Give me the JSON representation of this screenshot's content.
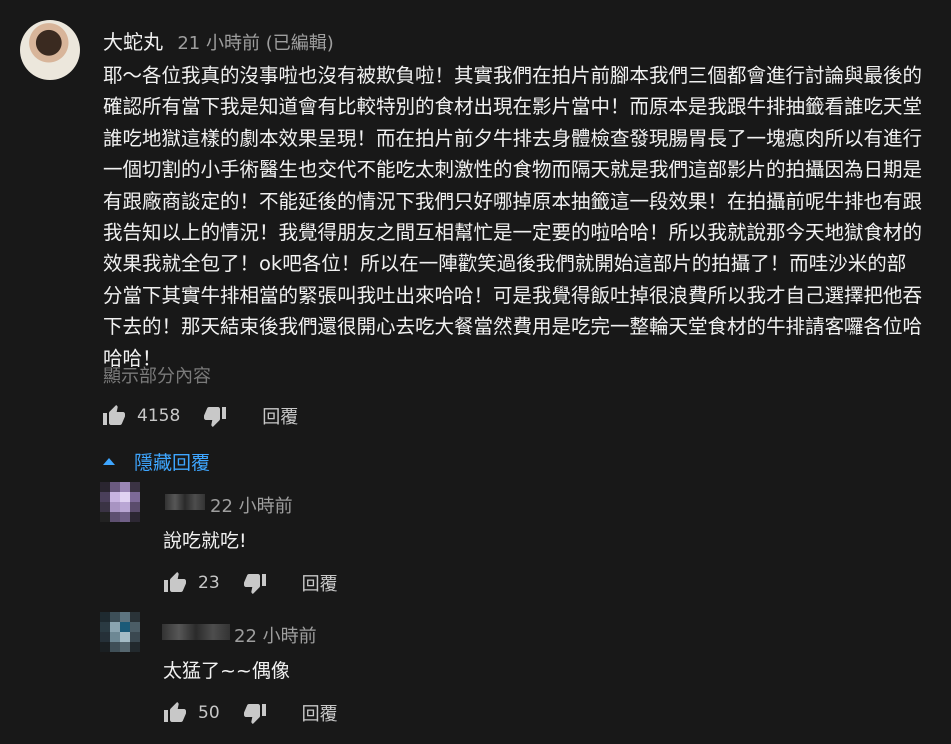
{
  "comment": {
    "author": "大蛇丸",
    "time": "21 小時前 (已編輯)",
    "text": "耶～各位我真的沒事啦也沒有被欺負啦！其實我們在拍片前腳本我們三個都會進行討論與最後的確認所有當下我是知道會有比較特別的食材出現在影片當中！而原本是我跟牛排抽籤看誰吃天堂誰吃地獄這樣的劇本效果呈現！而在拍片前夕牛排去身體檢查發現腸胃長了一塊瘜肉所以有進行一個切割的小手術醫生也交代不能吃太刺激性的食物而隔天就是我們這部影片的拍攝因為日期是有跟廠商談定的！不能延後的情況下我們只好哪掉原本抽籤這一段效果！在拍攝前呢牛排也有跟我告知以上的情況！我覺得朋友之間互相幫忙是一定要的啦哈哈！所以我就說那今天地獄食材的效果我就全包了！ok吧各位！所以在一陣歡笑過後我們就開始這部片的拍攝了！而哇沙米的部分當下其實牛排相當的緊張叫我吐出來哈哈！可是我覺得飯吐掉很浪費所以我才自己選擇把他吞下去的！那天結束後我們還很開心去吃大餐當然費用是吃完一整輪天堂食材的牛排請客囉各位哈哈哈！",
    "show_partial": "顯示部分內容",
    "likes": "4158",
    "reply_label": "回覆",
    "like_icon": "thumbs-up-icon",
    "dislike_icon": "thumbs-down-icon"
  },
  "replies_toggle": {
    "label": "隱藏回覆",
    "icon": "caret-up-icon",
    "color": "#3ea6ff"
  },
  "replies": [
    {
      "time": "22 小時前",
      "text": "說吃就吃!",
      "likes": "23",
      "reply_label": "回覆"
    },
    {
      "time": "22 小時前",
      "text": "太猛了~~偶像",
      "likes": "50",
      "reply_label": "回覆"
    }
  ]
}
